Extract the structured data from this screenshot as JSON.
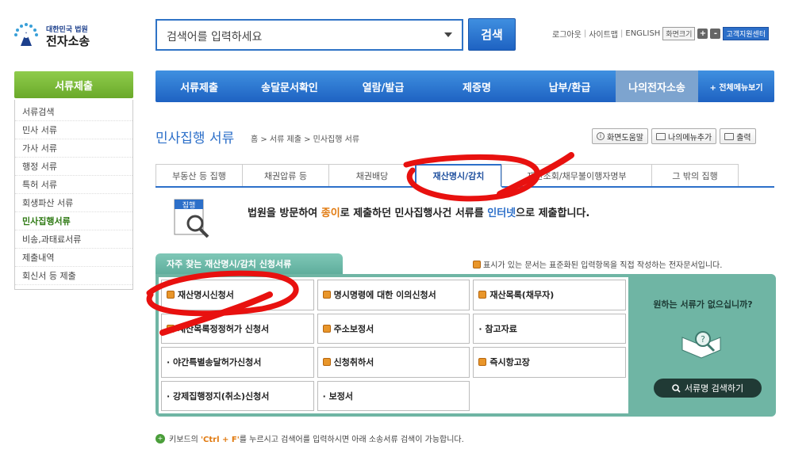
{
  "logo": {
    "org": "대한민국 법원",
    "name": "전자소송"
  },
  "search": {
    "placeholder": "검색어를 입력하세요",
    "button": "검색"
  },
  "util": {
    "logout": "로그아웃",
    "sitemap": "사이트맵",
    "english": "ENGLISH",
    "font_size": "화면크기",
    "plus": "+",
    "minus": "-",
    "support": "고객지원센터"
  },
  "left_nav": {
    "header": "서류제출",
    "items": [
      "서류검색",
      "민사 서류",
      "가사 서류",
      "행정 서류",
      "특허 서류",
      "회생파산 서류",
      "민사집행서류",
      "비송,과태료서류",
      "제출내역",
      "회신서 등 제출"
    ],
    "active_index": 6
  },
  "top_nav": {
    "items": [
      "서류제출",
      "송달문서확인",
      "열람/발급",
      "제증명",
      "납부/환급",
      "나의전자소송",
      "+ 전체메뉴보기"
    ],
    "active_index": 5
  },
  "page": {
    "title": "민사집행 서류",
    "breadcrumb": "홈 > 서류 제출 > 민사집행 서류",
    "tools": [
      "화면도움말",
      "나의메뉴추가",
      "출력"
    ]
  },
  "sub_tabs": {
    "items": [
      "부동산 등 집행",
      "채권압류 등",
      "채권배당",
      "재산명시/감치",
      "재산조회/채무불이행자명부",
      "그 밖의 집행"
    ],
    "active_index": 3
  },
  "intro": {
    "icon_label": "집행",
    "p1": "법원을 방문하여 ",
    "h1": "종이",
    "p2": "로 제출하던 민사집행사건 서류를 ",
    "h2": "인터넷",
    "p3": "으로 제출합니다."
  },
  "panel": {
    "tab": "자주 찾는 재산명시/감치 신청서류",
    "note": "표시가 있는 문서는 표준화된 입력항목을 직접 작성하는 전자문서입니다.",
    "cells": [
      {
        "label": "재산명시신청서",
        "icon": "doc-icon"
      },
      {
        "label": "명시명령에 대한 이의신청서",
        "icon": "doc-icon"
      },
      {
        "label": "재산목록(채무자)",
        "icon": "doc-icon"
      },
      {
        "label": "재산목록정정허가 신청서",
        "icon": "doc-icon"
      },
      {
        "label": "주소보정서",
        "icon": "doc-icon"
      },
      {
        "label": "· 참고자료",
        "icon": ""
      },
      {
        "label": "· 야간특별송달허가신청서",
        "icon": ""
      },
      {
        "label": "신청취하서",
        "icon": "doc-icon"
      },
      {
        "label": "즉시항고장",
        "icon": "doc-icon"
      },
      {
        "label": "· 강제집행정지(취소)신청서",
        "icon": ""
      },
      {
        "label": "· 보정서",
        "icon": ""
      },
      {
        "label": "",
        "icon": ""
      }
    ],
    "side_question": "원하는 서류가 없으십니까?",
    "side_button": "서류명 검색하기"
  },
  "footer": {
    "p1": "키보드의 ",
    "hotkey": "'Ctrl + F'",
    "p2": "를 누르시고 검색어를 입력하시면 아래 소송서류 검색이 가능합니다."
  },
  "colors": {
    "brand_blue": "#2c6fc9",
    "nav_green": "#7bbd3a",
    "panel_teal": "#6fb5a4",
    "annotation_red": "#e8110f"
  }
}
